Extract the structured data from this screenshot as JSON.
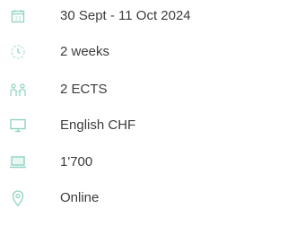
{
  "accent_color": "#8fd3c3",
  "info_items": [
    {
      "icon": "calendar-icon",
      "label": "30 Sept - 11 Oct 2024"
    },
    {
      "icon": "clock-icon",
      "label": "2 weeks"
    },
    {
      "icon": "people-icon",
      "label": "2 ECTS"
    },
    {
      "icon": "monitor-icon",
      "label": "English CHF"
    },
    {
      "icon": "laptop-icon",
      "label": "1'700"
    },
    {
      "icon": "location-pin-icon",
      "label": "Online"
    }
  ]
}
